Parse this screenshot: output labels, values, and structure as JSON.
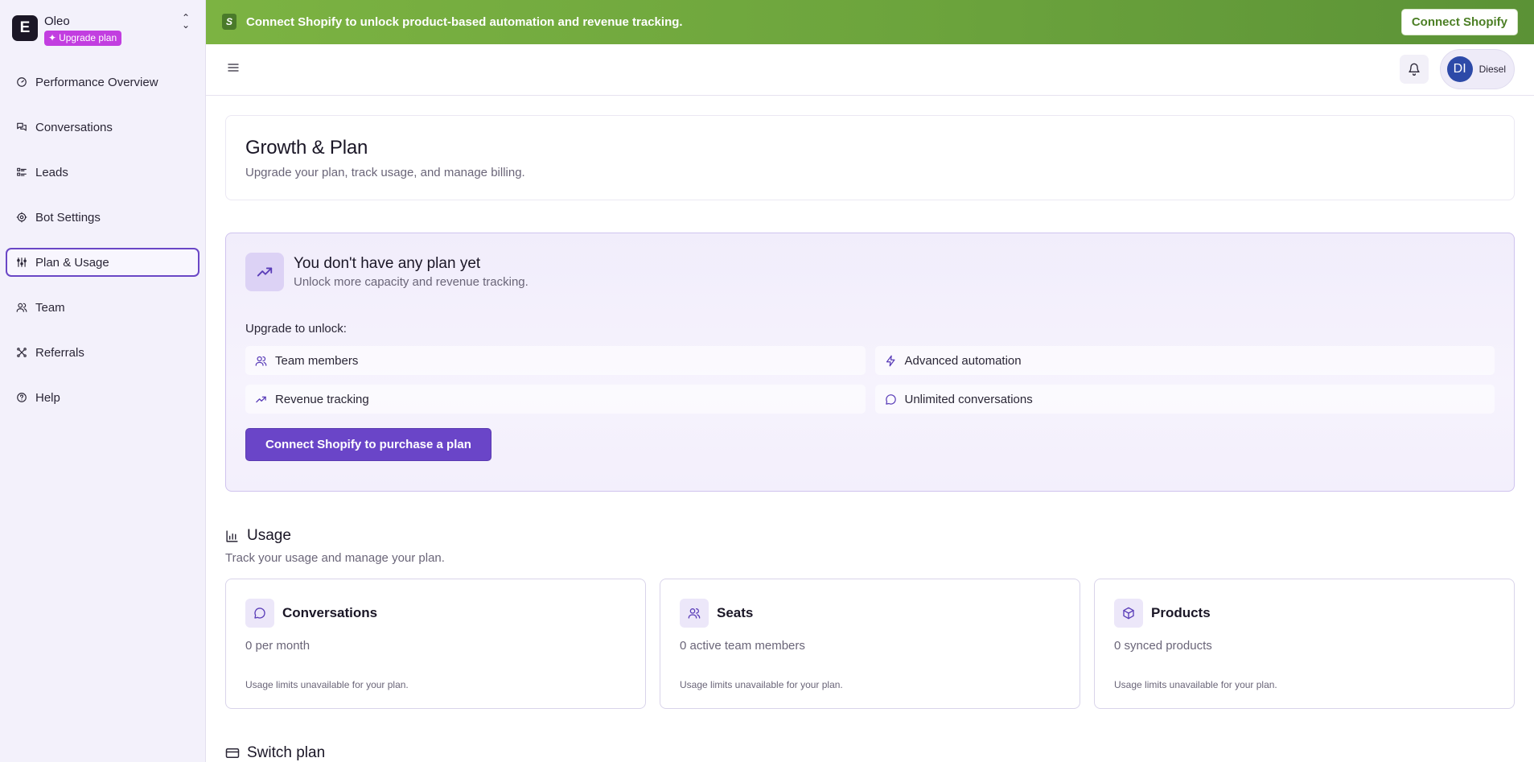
{
  "brand": {
    "name": "Oleo",
    "logo_letter": "E",
    "upgrade_label": "Upgrade plan"
  },
  "sidebar": {
    "items": [
      {
        "label": "Performance Overview",
        "icon": "gauge-icon"
      },
      {
        "label": "Conversations",
        "icon": "chat-bubbles-icon"
      },
      {
        "label": "Leads",
        "icon": "list-check-icon"
      },
      {
        "label": "Bot Settings",
        "icon": "gear-icon"
      },
      {
        "label": "Plan & Usage",
        "icon": "sliders-icon",
        "active": true
      },
      {
        "label": "Team",
        "icon": "users-icon"
      },
      {
        "label": "Referrals",
        "icon": "share-nodes-icon"
      },
      {
        "label": "Help",
        "icon": "help-circle-icon"
      }
    ]
  },
  "banner": {
    "logo_letter": "S",
    "text": "Connect Shopify to unlock product-based automation and revenue tracking.",
    "button_label": "Connect Shopify"
  },
  "topbar": {
    "user_initials": "DI",
    "user_name": "Diesel"
  },
  "page": {
    "title": "Growth & Plan",
    "subtitle": "Upgrade your plan, track usage, and manage billing."
  },
  "plan": {
    "title": "You don't have any plan yet",
    "subtitle": "Unlock more capacity and revenue tracking.",
    "unlock_label": "Upgrade to unlock:",
    "features": [
      {
        "label": "Team members",
        "icon": "users-icon"
      },
      {
        "label": "Advanced automation",
        "icon": "lightning-icon"
      },
      {
        "label": "Revenue tracking",
        "icon": "trending-up-icon"
      },
      {
        "label": "Unlimited conversations",
        "icon": "chat-bubble-icon"
      }
    ],
    "cta_label": "Connect Shopify to purchase a plan"
  },
  "usage": {
    "title": "Usage",
    "subtitle": "Track your usage and manage your plan.",
    "cards": [
      {
        "title": "Conversations",
        "value": "0 per month",
        "note": "Usage limits unavailable for your plan.",
        "icon": "chat-bubble-icon"
      },
      {
        "title": "Seats",
        "value": "0 active team members",
        "note": "Usage limits unavailable for your plan.",
        "icon": "users-icon"
      },
      {
        "title": "Products",
        "value": "0 synced products",
        "note": "Usage limits unavailable for your plan.",
        "icon": "box-icon"
      }
    ]
  },
  "switch_plan": {
    "title": "Switch plan"
  },
  "colors": {
    "accent": "#6a45c8",
    "banner_green": "#7cb342",
    "badge_magenta": "#c23ee0",
    "sidebar_bg": "#f3f1fb"
  }
}
